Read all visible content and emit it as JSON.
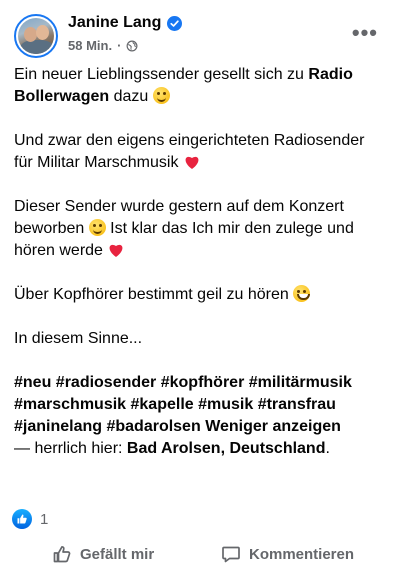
{
  "post": {
    "author": "Janine Lang",
    "time": "58 Min.",
    "meta_separator": "·",
    "privacy_icon": "globe-icon",
    "verified_icon": "verified-badge-icon",
    "more_label": "•••",
    "paragraph1_text": "Ein neuer Lieblingssender gesellt sich zu ",
    "paragraph1_bold": "Radio Bollerwagen",
    "paragraph1_tail": " dazu ",
    "paragraph2": "Und zwar den eigens eingerichteten Radiosender für Militar Marschmusik ",
    "paragraph3_a": "Dieser Sender wurde gestern auf dem Konzert beworben ",
    "paragraph3_b": " Ist klar das Ich mir den zulege und hören werde ",
    "paragraph4": "Über Kopfhörer bestimmt geil zu hören ",
    "paragraph5": "In diesem Sinne...",
    "hashtags": "#neu #radiosender #kopfhörer #militärmusik #marschmusik #kapelle #musik #transfrau #janinelang #badarolsen",
    "show_less": "Weniger anzeigen",
    "location_prefix": "— herrlich hier: ",
    "location_name": "Bad Arolsen, Deutschland",
    "location_suffix": "."
  },
  "reactions": {
    "icon": "like-reaction-icon",
    "count": "1"
  },
  "actions": {
    "like_label": "Gefällt mir",
    "comment_label": "Kommentieren"
  },
  "colors": {
    "accent": "#1877f2",
    "text": "#050505",
    "secondary_text": "#65676b",
    "heart": "#e8233f",
    "emoji": "#f7b500"
  }
}
